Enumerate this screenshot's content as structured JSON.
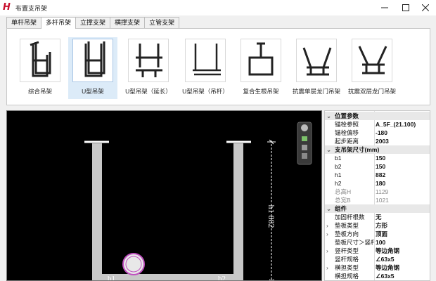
{
  "window": {
    "title": "布置支吊架",
    "logo_char": "H",
    "controls": [
      "minimize-icon",
      "maximize-icon",
      "close-icon"
    ]
  },
  "tabs": [
    {
      "label": "单杆吊架",
      "active": false
    },
    {
      "label": "多杆吊架",
      "active": true
    },
    {
      "label": "立撑支架",
      "active": false
    },
    {
      "label": "横撑支架",
      "active": false
    },
    {
      "label": "立管支架",
      "active": false
    }
  ],
  "gallery": [
    {
      "label": "综合吊架",
      "icon": "combined-hanger-icon",
      "selected": false
    },
    {
      "label": "U型吊架",
      "icon": "u-hanger-icon",
      "selected": true
    },
    {
      "label": "U型吊架（延长）",
      "icon": "u-hanger-extended-icon",
      "selected": false
    },
    {
      "label": "U型吊架（吊杆）",
      "icon": "u-hanger-rod-icon",
      "selected": false
    },
    {
      "label": "复合生根吊架",
      "icon": "composite-root-hanger-icon",
      "selected": false
    },
    {
      "label": "抗震单层龙门吊架",
      "icon": "seismic-single-gantry-icon",
      "selected": false
    },
    {
      "label": "抗震双层龙门吊架",
      "icon": "seismic-double-gantry-icon",
      "selected": false
    }
  ],
  "canvas": {
    "dim_h1": "h1 882",
    "label_b1": "b1",
    "label_b2": "b2",
    "dim_bottom": "180",
    "toolbar_icons": [
      "view-cube-icon",
      "pan-icon",
      "zoom-icon",
      "steering-icon"
    ],
    "colors": {
      "frame": "#c8c8c8",
      "pipe": "#c050c0",
      "dimension": "#ffffff"
    }
  },
  "properties": {
    "categories": [
      {
        "name": "位置参数",
        "rows": [
          {
            "key": "锚栓参照",
            "value": "A_5F_(21.100)",
            "dim": false,
            "expand": false
          },
          {
            "key": "锚栓偏移",
            "value": "-180",
            "dim": false,
            "expand": false
          },
          {
            "key": "起步距离",
            "value": "2003",
            "dim": false,
            "expand": false
          }
        ]
      },
      {
        "name": "支吊架尺寸(mm)",
        "rows": [
          {
            "key": "b1",
            "value": "150",
            "dim": false,
            "expand": false
          },
          {
            "key": "b2",
            "value": "150",
            "dim": false,
            "expand": false
          },
          {
            "key": "h1",
            "value": "882",
            "dim": false,
            "expand": false
          },
          {
            "key": "h2",
            "value": "180",
            "dim": false,
            "expand": false
          },
          {
            "key": "总高H",
            "value": "1129",
            "dim": true,
            "expand": false
          },
          {
            "key": "总宽B",
            "value": "1021",
            "dim": true,
            "expand": false
          }
        ]
      },
      {
        "name": "组件",
        "rows": [
          {
            "key": "加固杆根数",
            "value": "无",
            "dim": false,
            "expand": false
          },
          {
            "key": "垫板类型",
            "value": "方形",
            "dim": false,
            "expand": true
          },
          {
            "key": "垫板方向",
            "value": "顶面",
            "dim": false,
            "expand": true
          },
          {
            "key": "垫板尺寸＞竖杆",
            "value": "100",
            "dim": false,
            "expand": false
          },
          {
            "key": "竖杆类型",
            "value": "等边角钢",
            "dim": false,
            "expand": true
          },
          {
            "key": "竖杆规格",
            "value": "∠63x5",
            "dim": false,
            "expand": false
          },
          {
            "key": "横担类型",
            "value": "等边角钢",
            "dim": false,
            "expand": true
          },
          {
            "key": "横担规格",
            "value": "∠63x5",
            "dim": false,
            "expand": false
          }
        ]
      }
    ]
  }
}
